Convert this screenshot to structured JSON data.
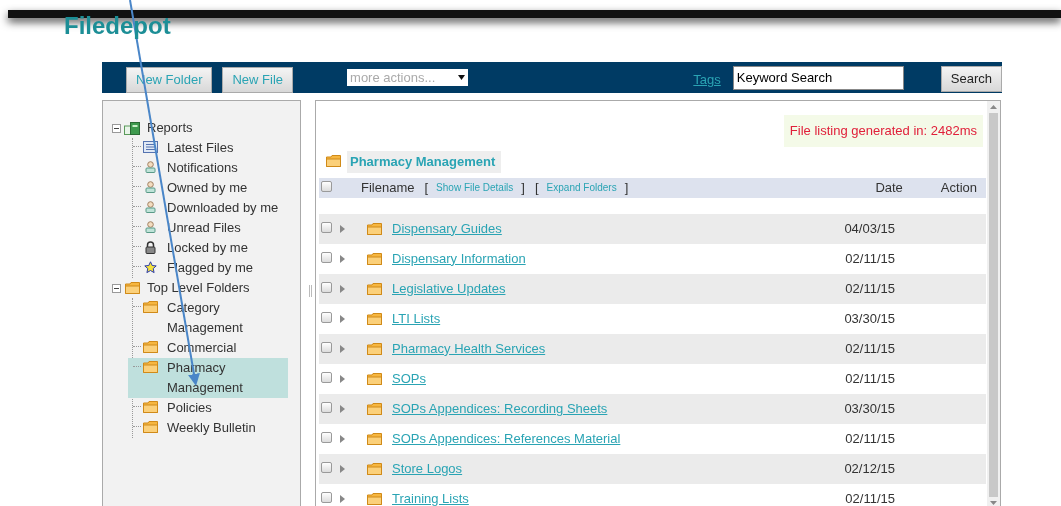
{
  "title": "Filedepot",
  "toolbar": {
    "buttons": [
      "New Folder",
      "New File"
    ],
    "actions_select": "more actions...",
    "tags_link": "Tags",
    "search": {
      "value": "Keyword Search"
    },
    "search_button": "Search"
  },
  "tree": [
    {
      "label": "Reports",
      "kind": "reports",
      "expanded": true,
      "selected": false,
      "children": [
        {
          "label": "Latest Files",
          "kind": "list",
          "selected": false
        },
        {
          "label": "Notifications",
          "kind": "person",
          "selected": false
        },
        {
          "label": "Owned by me",
          "kind": "person",
          "selected": false
        },
        {
          "label": "Downloaded by me",
          "kind": "person",
          "selected": false
        },
        {
          "label": "Unread Files",
          "kind": "person",
          "selected": false
        },
        {
          "label": "Locked by me",
          "kind": "lock",
          "selected": false
        },
        {
          "label": "Flagged by me",
          "kind": "star",
          "selected": false
        }
      ]
    },
    {
      "label": "Top Level Folders",
      "kind": "folder",
      "expanded": true,
      "selected": false,
      "children": [
        {
          "label": "Category Management",
          "kind": "folder",
          "selected": false
        },
        {
          "label": "Commercial",
          "kind": "folder",
          "selected": false
        },
        {
          "label": "Pharmacy Management",
          "kind": "folder",
          "selected": true
        },
        {
          "label": "Policies",
          "kind": "folder",
          "selected": false
        },
        {
          "label": "Weekly Bulletin",
          "kind": "folder",
          "selected": false
        }
      ]
    }
  ],
  "status_message": "File listing generated in: 2482ms",
  "breadcrumb": "Pharmacy Management",
  "table": {
    "columns": [
      "Filename",
      "Date",
      "Action"
    ],
    "header_links": [
      {
        "open": "[",
        "label": "Show File Details",
        "close": "]"
      },
      {
        "open": "[",
        "label": "Expand Folders",
        "close": "]"
      }
    ],
    "header_checked": false,
    "rows": [
      {
        "name": "Dispensary Guides",
        "date": "04/03/15",
        "checked": false
      },
      {
        "name": "Dispensary Information",
        "date": "02/11/15",
        "checked": false
      },
      {
        "name": "Legislative Updates",
        "date": "02/11/15",
        "checked": false
      },
      {
        "name": "LTI Lists",
        "date": "03/30/15",
        "checked": false
      },
      {
        "name": "Pharmacy Health Services",
        "date": "02/11/15",
        "checked": false
      },
      {
        "name": "SOPs",
        "date": "02/11/15",
        "checked": false
      },
      {
        "name": "SOPs Appendices: Recording Sheets",
        "date": "03/30/15",
        "checked": false
      },
      {
        "name": "SOPs Appendices: References Material",
        "date": "02/11/15",
        "checked": false
      },
      {
        "name": "Store Logos",
        "date": "02/12/15",
        "checked": false
      },
      {
        "name": "Training Lists",
        "date": "02/11/15",
        "checked": false
      }
    ]
  }
}
